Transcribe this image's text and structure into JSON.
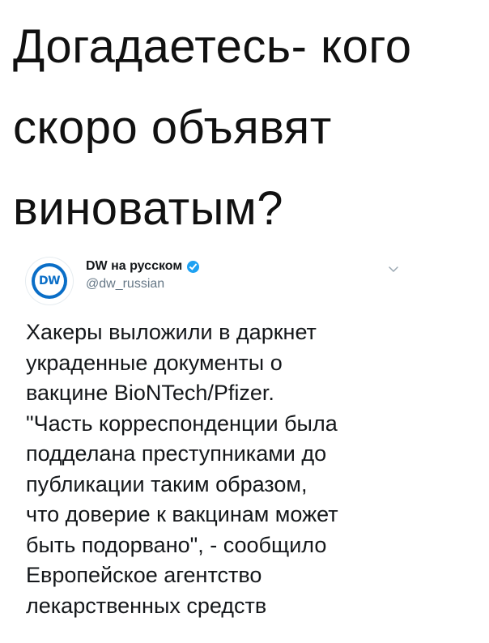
{
  "headline": {
    "lines": [
      "Догадаетесь- кого",
      "скоро объявят",
      "виноватым?"
    ]
  },
  "tweet": {
    "author": {
      "name": "DW на русском",
      "handle": "@dw_russian",
      "verified": true,
      "avatar_logo": "DW"
    },
    "menu_icon": "chevron-down-icon",
    "text_lines": [
      "Хакеры выложили в даркнет",
      "украденные документы о",
      "вакцине BioNTech/Pfizer.",
      "\"Часть корреспонденции была",
      "подделана преступниками до",
      "публикации таким образом,",
      "что доверие к вакцинам может",
      "быть подорвано\", - сообщило",
      "Европейское агентство",
      "лекарственных средств"
    ]
  },
  "colors": {
    "brand_blue": "#0a6ec7",
    "verified_blue": "#1da1f2",
    "secondary_text": "#657786"
  }
}
